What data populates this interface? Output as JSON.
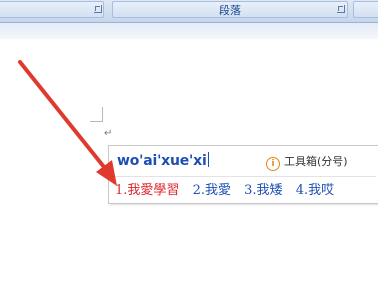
{
  "ribbon": {
    "group_label": "段落"
  },
  "document": {
    "paragraph_mark": "↵"
  },
  "ime": {
    "pinyin": "wo'ai'xue'xi",
    "toolbox_label": "工具箱(分号)",
    "candidates": [
      {
        "num": "1.",
        "text": "我愛學習"
      },
      {
        "num": "2.",
        "text": "我愛"
      },
      {
        "num": "3.",
        "text": "我矮"
      },
      {
        "num": "4.",
        "text": "我哎"
      }
    ],
    "selected_color": "#e0262c",
    "candidate_color": "#1e50b4"
  },
  "annotation": {
    "arrow_color": "#e03a2e"
  }
}
